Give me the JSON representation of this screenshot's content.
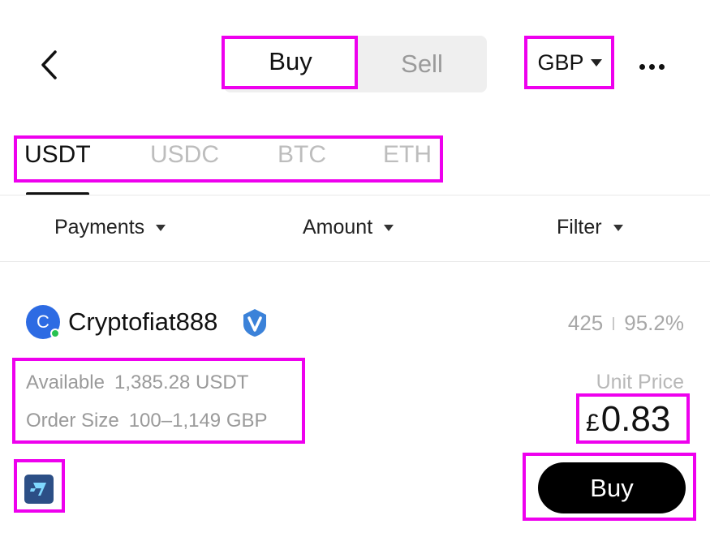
{
  "header": {
    "back_icon": "chevron-left-icon",
    "tabs": {
      "buy": "Buy",
      "sell": "Sell",
      "active": "buy"
    },
    "currency": "GBP",
    "more_icon": "more-horizontal-icon"
  },
  "coins": {
    "items": [
      "USDT",
      "USDC",
      "BTC",
      "ETH"
    ],
    "active": "USDT"
  },
  "filters": {
    "payments": "Payments",
    "amount": "Amount",
    "filter": "Filter"
  },
  "listing": {
    "avatar_letter": "C",
    "merchant_name": "Cryptofiat888",
    "verified_icon": "verified-badge-icon",
    "orders": "425",
    "completion_rate": "95.2%",
    "available_label": "Available",
    "available_value": "1,385.28 USDT",
    "order_size_label": "Order Size",
    "order_size_value": "100–1,149 GBP",
    "unit_price_label": "Unit Price",
    "price_symbol": "£",
    "price_value": "0.83",
    "payment_method_icon": "wise-icon",
    "buy_label": "Buy"
  },
  "colors": {
    "highlight": "#ee00ee",
    "avatar": "#2d6be3",
    "verified": "#3b82d9",
    "online": "#26c250",
    "buy_button": "#000000"
  }
}
